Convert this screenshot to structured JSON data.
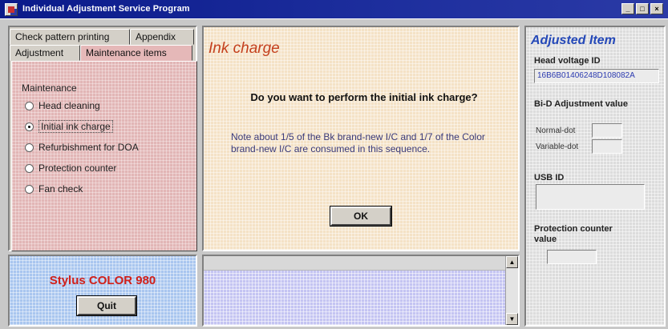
{
  "window": {
    "title": "Individual Adjustment Service Program",
    "controls": [
      "_",
      "□",
      "×"
    ]
  },
  "tabs": {
    "row1": [
      "Check pattern printing",
      "Appendix"
    ],
    "row2": [
      "Adjustment",
      "Maintenance items"
    ],
    "active": "Maintenance items"
  },
  "maintenance": {
    "group_label": "Maintenance",
    "options": [
      {
        "label": "Head cleaning",
        "checked": false
      },
      {
        "label": "Initial ink charge",
        "checked": true
      },
      {
        "label": "Refurbishment for DOA",
        "checked": false
      },
      {
        "label": "Protection counter",
        "checked": false
      },
      {
        "label": "Fan check",
        "checked": false
      }
    ]
  },
  "dialog": {
    "title": "Ink charge",
    "question": "Do you want to perform the initial ink charge?",
    "note": "Note about 1/5 of the Bk brand-new I/C and 1/7 of the Color brand-new I/C are consumed in this sequence.",
    "ok_label": "OK"
  },
  "product": {
    "name": "Stylus COLOR 980",
    "quit_label": "Quit"
  },
  "adjusted": {
    "title": "Adjusted Item",
    "head_voltage_label": "Head voltage ID",
    "head_voltage_value": "16B6B01406248D108082A",
    "bi_d_label": "Bi-D Adjustment value",
    "normal_dot_label": "Normal-dot",
    "normal_dot_value": "",
    "variable_dot_label": "Variable-dot",
    "variable_dot_value": "",
    "usb_label": "USB ID",
    "usb_value": "",
    "protection_label": "Protection counter value",
    "protection_value": ""
  },
  "colors": {
    "titlebar": "#0a1a8a",
    "tab_body": "#e2b6b6",
    "dialog_bg": "#f4e2c6",
    "logo_bg": "#a9c6ef",
    "product_text": "#d0201a",
    "dialog_title": "#c4401e",
    "adjusted_title": "#2448b8"
  }
}
